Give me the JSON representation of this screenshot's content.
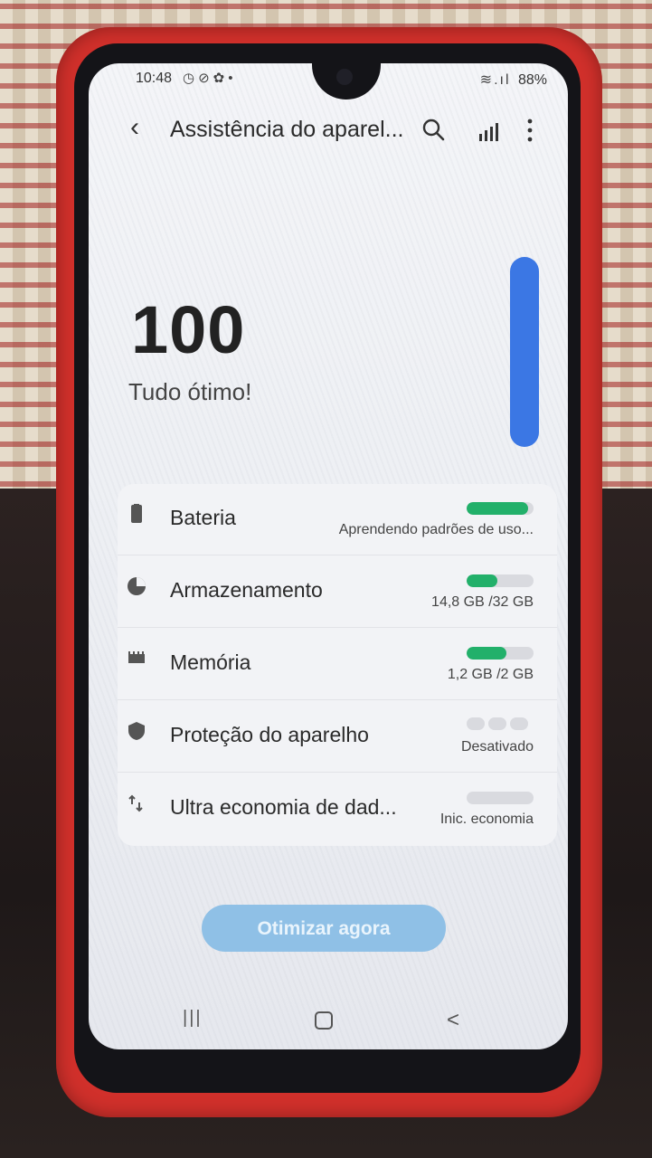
{
  "status_bar": {
    "time": "10:48",
    "left_icons": "◷⊘✿•",
    "right_icons": "≋.ıl",
    "battery": "88%"
  },
  "header": {
    "title": "Assistência do aparel...",
    "back_icon": "chevron-left",
    "search_icon": "search",
    "signal_icon": "signal-bars",
    "more_icon": "vertical-dots"
  },
  "score": {
    "value": "100",
    "status": "Tudo ótimo!",
    "level": 1.0,
    "bar_color": "#3b77e4"
  },
  "items": [
    {
      "label": "Bateria",
      "subtitle": "Aprendendo padrões de uso...",
      "bar_fraction": 0.92,
      "icon": "battery-icon"
    },
    {
      "label": "Armazenamento",
      "subtitle": "14,8 GB /32 GB",
      "bar_fraction": 0.46,
      "icon": "storage-icon"
    },
    {
      "label": "Memória",
      "subtitle": "1,2 GB /2 GB",
      "bar_fraction": 0.6,
      "icon": "memory-icon"
    },
    {
      "label": "Proteção do aparelho",
      "subtitle": "Desativado",
      "icon": "shield-icon"
    },
    {
      "label": "Ultra economia de dad...",
      "subtitle": "Inic. economia",
      "icon": "data-saver-icon"
    }
  ],
  "accent_green": "#22b06a",
  "optimize_button": "Otimizar agora",
  "nav": {
    "recent": "|||",
    "back": "<"
  }
}
